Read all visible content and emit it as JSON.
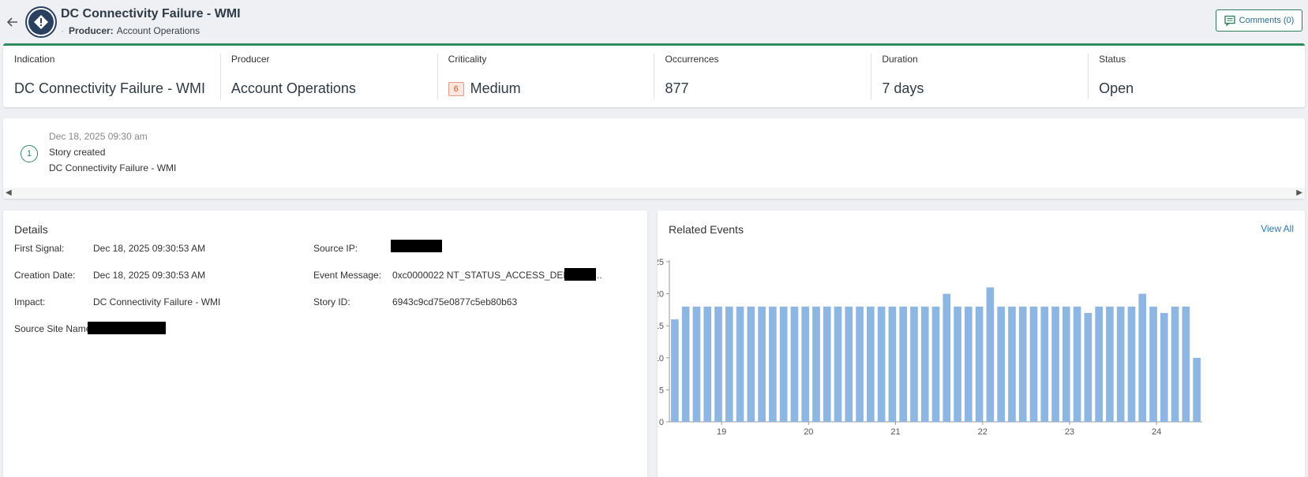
{
  "header": {
    "title": "DC Connectivity Failure - WMI",
    "producer_label": "Producer:",
    "producer_value": "Account Operations",
    "comments_label": "Comments (0)"
  },
  "summary": [
    {
      "label": "Indication",
      "value": "DC Connectivity Failure - WMI"
    },
    {
      "label": "Producer",
      "value": "Account Operations"
    },
    {
      "label": "Criticality",
      "value": "Medium",
      "badge": "6"
    },
    {
      "label": "Occurrences",
      "value": "877"
    },
    {
      "label": "Duration",
      "value": "7 days"
    },
    {
      "label": "Status",
      "value": "Open"
    }
  ],
  "timeline": {
    "step": "1",
    "date": "Dec 18, 2025 09:30 am",
    "event": "Story created",
    "name": "DC Connectivity Failure - WMI"
  },
  "details": {
    "title": "Details",
    "first_signal_label": "First Signal:",
    "first_signal_value": "Dec 18, 2025 09:30:53 AM",
    "creation_date_label": "Creation Date:",
    "creation_date_value": "Dec 18, 2025 09:30:53 AM",
    "impact_label": "Impact:",
    "impact_value": "DC Connectivity Failure - WMI",
    "source_site_label": "Source Site Name:",
    "source_ip_label": "Source IP:",
    "event_message_label": "Event Message:",
    "event_message_value": "0xc0000022 NT_STATUS_ACCESS_DENIED (",
    "story_id_label": "Story ID:",
    "story_id_value": "6943c9cd75e0877c5eb80b63"
  },
  "related": {
    "title": "Related Events",
    "view_all": "View All"
  },
  "colors": {
    "accent": "#2e8b5e",
    "bar": "#8db6e3",
    "link": "#2a7ab0"
  },
  "chart_data": {
    "type": "bar",
    "ylim": [
      0,
      25
    ],
    "yticks": [
      0,
      5,
      10,
      15,
      20,
      25
    ],
    "xtick_labels": [
      "19",
      "20",
      "21",
      "22",
      "23",
      "24"
    ],
    "xtick_positions": [
      4.8,
      12.8,
      20.8,
      28.8,
      36.8,
      44.8
    ],
    "values": [
      16,
      18,
      18,
      18,
      18,
      18,
      18,
      18,
      18,
      18,
      18,
      18,
      18,
      18,
      18,
      18,
      18,
      18,
      18,
      18,
      18,
      18,
      18,
      18,
      18,
      20,
      18,
      18,
      18,
      21,
      18,
      18,
      18,
      18,
      18,
      18,
      18,
      18,
      17,
      18,
      18,
      18,
      18,
      20,
      18,
      17,
      18,
      18,
      10
    ]
  }
}
